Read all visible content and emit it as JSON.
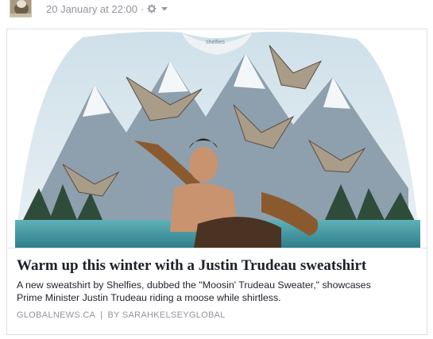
{
  "post": {
    "timestamp": "20 January at 22:00",
    "separator": "·",
    "privacy_icon": "friends-cog-icon",
    "menu_icon": "chevron-down-icon"
  },
  "link_card": {
    "image_alt_icon": "sweatshirt-photo",
    "brand_tag": "shelfies",
    "title": "Warm up this winter with a Justin Trudeau sweatshirt",
    "description_line1": "A new sweatshirt by Shelfies, dubbed the \"Moosin' Trudeau Sweater,\" showcases",
    "description_line2": "Prime Minister Justin Trudeau riding a moose while shirtless.",
    "source": "GLOBALNEWS.CA",
    "divider": "|",
    "author": "BY SARAHKELSEYGLOBAL"
  },
  "colors": {
    "meta_text": "#90949c",
    "title_text": "#1d2129",
    "card_border": "#dddfe2"
  }
}
